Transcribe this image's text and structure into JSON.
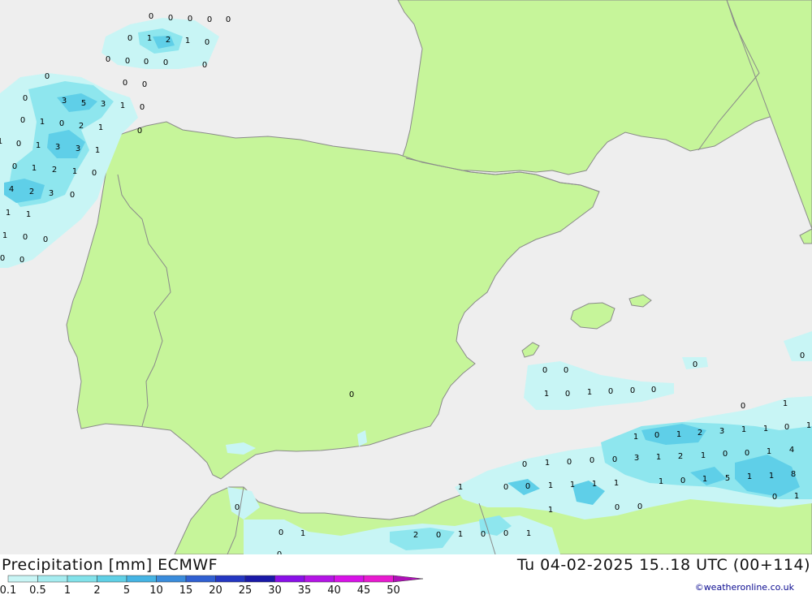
{
  "footer": {
    "title_left": "Precipitation [mm] ECMWF",
    "title_right": "Tu 04-02-2025 15..18 UTC (00+114)",
    "credit": "©weatheronline.co.uk"
  },
  "legend": {
    "tick_labels": [
      "0.1",
      "0.5",
      "1",
      "2",
      "5",
      "10",
      "15",
      "20",
      "25",
      "30",
      "35",
      "40",
      "45",
      "50"
    ],
    "colors": [
      "#c8f5f5",
      "#a5ecf0",
      "#82e2ea",
      "#5fd0e6",
      "#45b4e4",
      "#3a8cdc",
      "#3060d2",
      "#2437c2",
      "#1a19a8",
      "#8a10e8",
      "#b414e6",
      "#d812e8",
      "#e81ad0",
      "#b010b8"
    ]
  },
  "colors": {
    "sea": "#eeeeee",
    "land": "#c6f59a",
    "border": "#8a8a8a",
    "precip_light": "#c8f5f5",
    "precip_mid": "#8ee6ee",
    "precip_heavy": "#5fcfe8"
  },
  "map_values": [
    "0",
    "0",
    "0",
    "0",
    "0",
    "0",
    "1",
    "2",
    "1",
    "0",
    "0",
    "0",
    "0",
    "0",
    "0",
    "0",
    "0",
    "0",
    "3",
    "5",
    "3",
    "1",
    "0",
    "0",
    "1",
    "0",
    "2",
    "1",
    "0",
    "1",
    "0",
    "1",
    "3",
    "3",
    "1",
    "0",
    "1",
    "2",
    "1",
    "0",
    "4",
    "2",
    "3",
    "0",
    "1",
    "1",
    "1",
    "0",
    "0",
    "0",
    "0",
    "0",
    "0",
    "0",
    "1",
    "0",
    "1",
    "0",
    "0",
    "0",
    "0",
    "0",
    "0",
    "1",
    "0",
    "1",
    "0",
    "1",
    "2",
    "3",
    "1",
    "1",
    "0",
    "1",
    "0",
    "1",
    "0",
    "0",
    "0",
    "3",
    "1",
    "2",
    "1",
    "0",
    "0",
    "1",
    "4",
    "1",
    "0",
    "0",
    "1",
    "1",
    "1",
    "1",
    "1",
    "0",
    "1",
    "5",
    "1",
    "1",
    "8",
    "0",
    "1",
    "1",
    "0",
    "0",
    "0",
    "2",
    "0",
    "1",
    "0",
    "0",
    "1",
    "0",
    "1",
    "0"
  ]
}
